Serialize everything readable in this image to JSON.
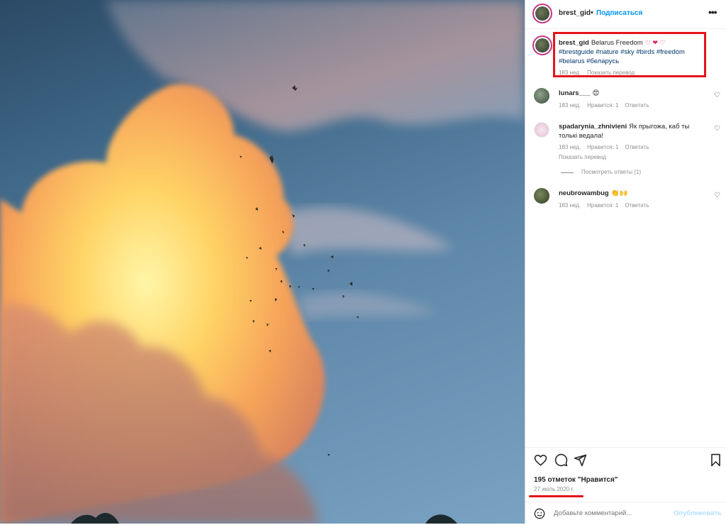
{
  "colors": {
    "accent_link": "#0095f6",
    "hashtag": "#00376b",
    "annotation_red": "#e5141a",
    "muted": "#8e8e8e"
  },
  "header": {
    "username": "brest_gid",
    "separator": "•",
    "follow_label": "Подписаться",
    "more_icon": "ellipsis-icon"
  },
  "caption": {
    "username": "brest_gid",
    "text": "Belarus Freedom",
    "emoji": "♡ ❤ ♡",
    "hashtags_line1": "#brestguide #nature #sky #birds #freedom",
    "hashtags_line2": "#belarus #беларусь",
    "time": "183 нед.",
    "translate": "Показать перевод"
  },
  "comments": [
    {
      "username": "lunars___",
      "text": "😍",
      "time": "183 нед.",
      "likes": "Нравится: 1",
      "reply": "Ответить"
    },
    {
      "username": "spadarynia_zhnivieni",
      "text_line1": "Як прыгожа, каб ты",
      "text_line2": "толькі ведала!",
      "time": "183 нед.",
      "likes": "Нравится: 1",
      "reply": "Ответить",
      "translate": "Показать перевод",
      "view_replies": "Посмотреть ответы (1)"
    },
    {
      "username": "neubrowambug",
      "text": "👏🙌",
      "time": "183 нед.",
      "likes": "Нравится: 1",
      "reply": "Ответить"
    }
  ],
  "footer": {
    "likes_count": "195 отметок \"Нравится\"",
    "date": "27 июль 2020 г.",
    "comment_placeholder": "Добавьте комментарий...",
    "publish_label": "Опубликовать"
  }
}
